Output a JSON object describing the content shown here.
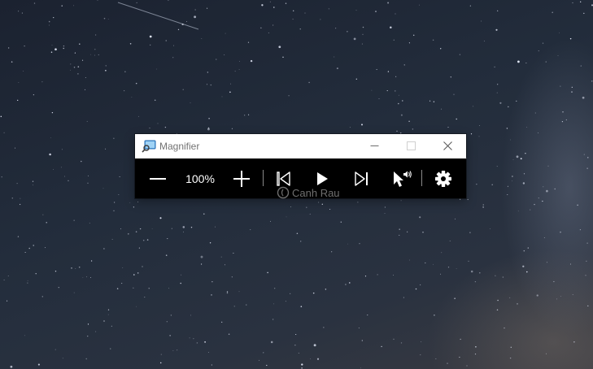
{
  "window": {
    "title": "Magnifier",
    "icon": "magnifier-app-icon",
    "controls": [
      "minimize-icon",
      "maximize-icon",
      "close-icon"
    ]
  },
  "toolbar": {
    "zoom_out": "minus-icon",
    "zoom_level": "100%",
    "zoom_in": "plus-icon",
    "previous": "skip-back-icon",
    "play": "play-icon",
    "next": "skip-forward-icon",
    "read_from_here": "pointer-speaker-icon",
    "settings": "gear-icon"
  },
  "watermark": {
    "text": "Canh Rau"
  },
  "colors": {
    "toolbar_bg": "#000000",
    "titlebar_bg": "#ffffff",
    "icon_fg": "#ffffff"
  }
}
